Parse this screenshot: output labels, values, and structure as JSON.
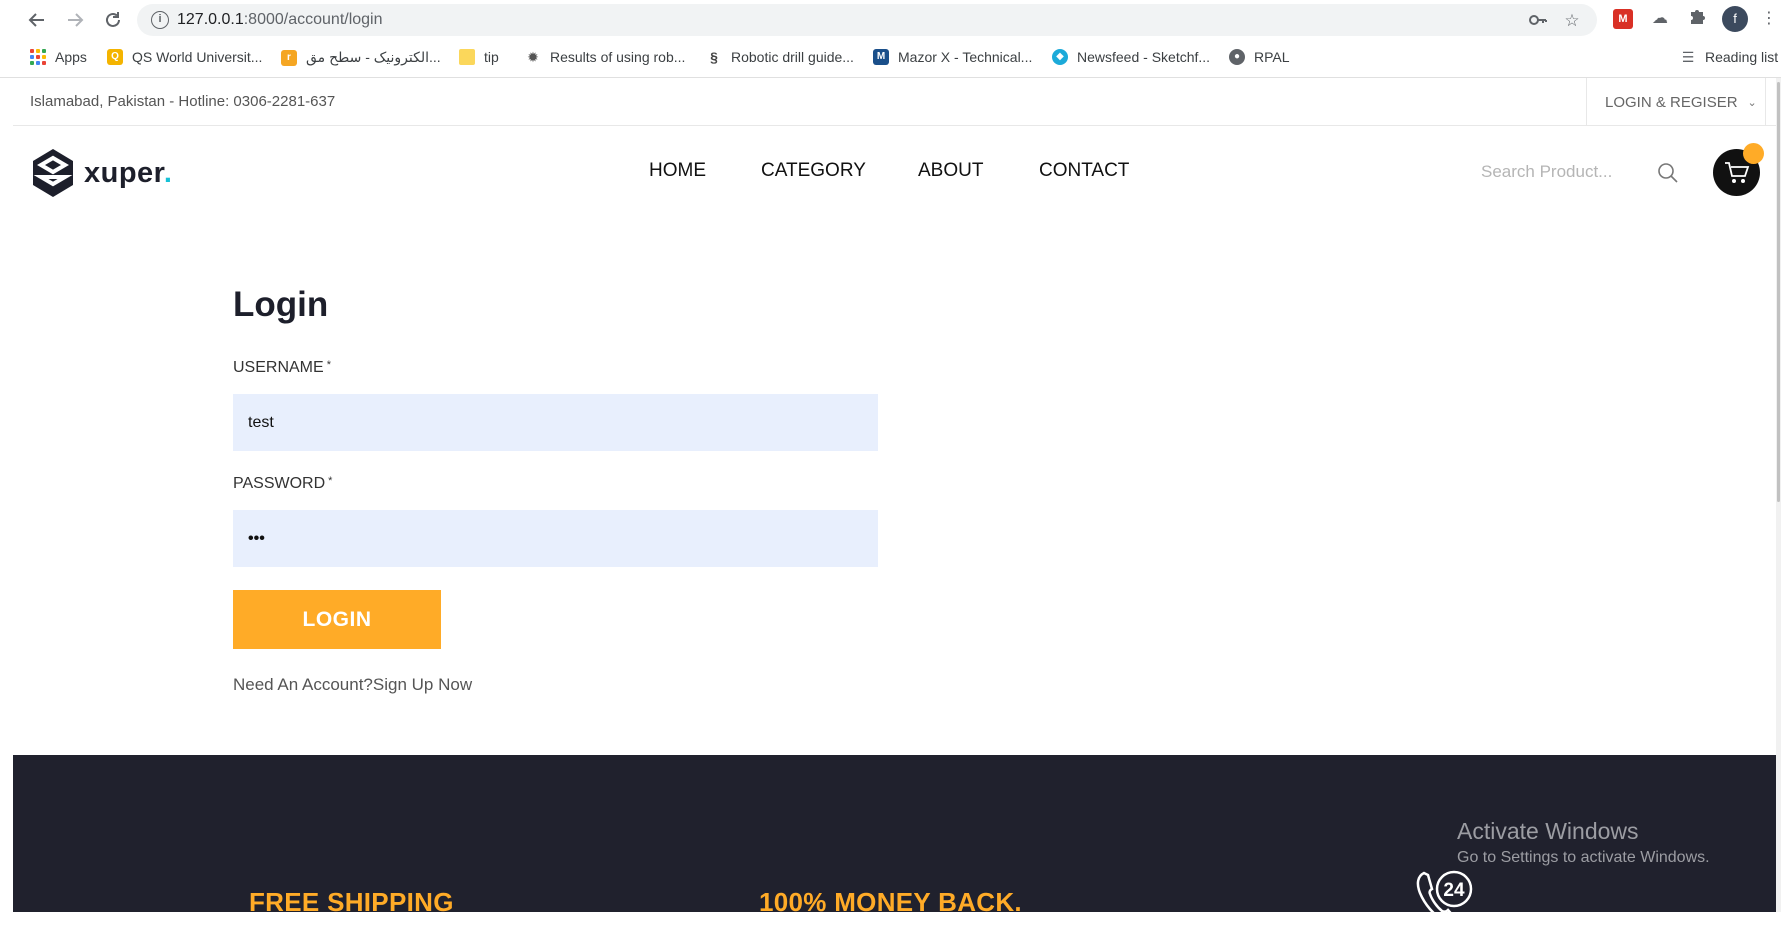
{
  "browser": {
    "url_host": "127.0.0.1",
    "url_path": ":8000/account/login",
    "bookmarks": [
      {
        "label": "Apps"
      },
      {
        "label": "QS World Universit..."
      },
      {
        "label": "الكترونيک - سطح مق..."
      },
      {
        "label": "tip"
      },
      {
        "label": "Results of using rob..."
      },
      {
        "label": "Robotic drill guide..."
      },
      {
        "label": "Mazor X - Technical..."
      },
      {
        "label": "Newsfeed - Sketchf..."
      },
      {
        "label": "RPAL"
      }
    ],
    "reading_list": "Reading list",
    "profile_initial": "f"
  },
  "topbar": {
    "location": "Islamabad, Pakistan - Hotline: 0306-2281-637",
    "login_register": "LOGIN & REGISER"
  },
  "logo": {
    "text": "xuper",
    "dot": "."
  },
  "nav": {
    "items": [
      {
        "label": "HOME"
      },
      {
        "label": "CATEGORY"
      },
      {
        "label": "ABOUT"
      },
      {
        "label": "CONTACT"
      }
    ]
  },
  "search": {
    "placeholder": "Search Product..."
  },
  "login": {
    "title": "Login",
    "username_label": "USERNAME",
    "username_value": "test",
    "password_label": "PASSWORD",
    "password_value": "•••",
    "required_mark": "*",
    "button": "LOGIN",
    "need_account": "Need An Account?",
    "signup": "Sign Up Now"
  },
  "footer": {
    "features": [
      {
        "title": "FREE SHIPPING"
      },
      {
        "title": "100% MONEY BACK."
      }
    ],
    "support_number": "24"
  },
  "watermark": {
    "title": "Activate Windows",
    "subtitle": "Go to Settings to activate Windows."
  },
  "colors": {
    "accent": "#ffab27",
    "footer_bg": "#20212d",
    "field_bg": "#e8effd"
  }
}
